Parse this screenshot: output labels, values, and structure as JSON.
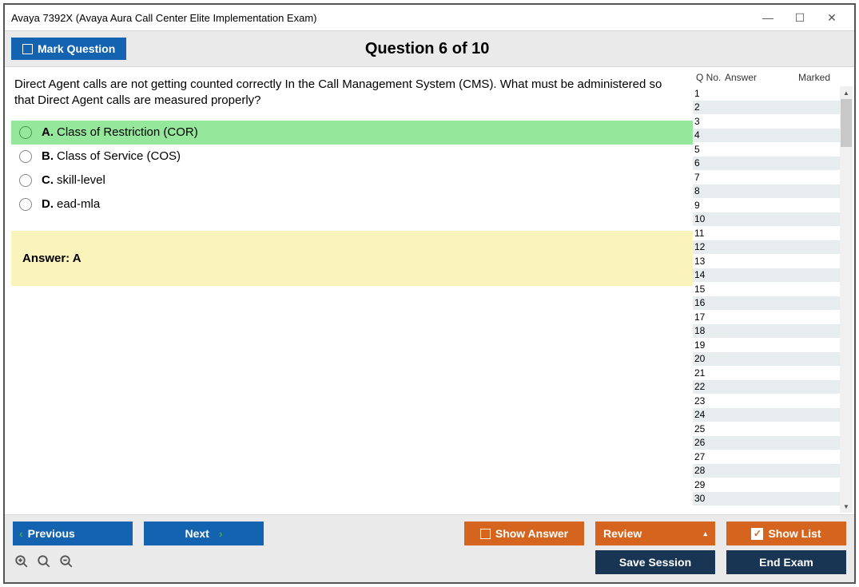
{
  "window_title": "Avaya 7392X (Avaya Aura Call Center Elite Implementation Exam)",
  "toolbar": {
    "mark_question": "Mark Question",
    "counter": "Question 6 of 10"
  },
  "question": {
    "text": "Direct Agent calls are not getting counted correctly In the Call Management System (CMS). What must be administered so that Direct Agent calls are measured properly?",
    "options": [
      {
        "letter": "A.",
        "text": "Class of Restriction (COR)",
        "highlight": true
      },
      {
        "letter": "B.",
        "text": "Class of Service (COS)",
        "highlight": false
      },
      {
        "letter": "C.",
        "text": "skill-level",
        "highlight": false
      },
      {
        "letter": "D.",
        "text": "ead-mla",
        "highlight": false
      }
    ],
    "answer_label": "Answer: A"
  },
  "qlist": {
    "headers": {
      "qno": "Q No.",
      "answer": "Answer",
      "marked": "Marked"
    },
    "count": 30
  },
  "footer": {
    "previous": "Previous",
    "next": "Next",
    "show_answer": "Show Answer",
    "review": "Review",
    "show_list": "Show List",
    "save_session": "Save Session",
    "end_exam": "End Exam"
  }
}
